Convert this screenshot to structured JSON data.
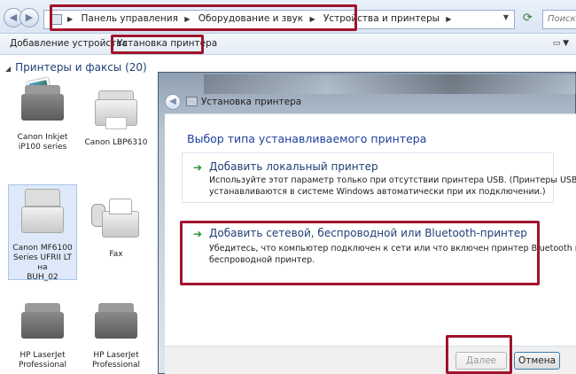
{
  "address_bar": {
    "breadcrumbs": [
      "Панель управления",
      "Оборудование и звук",
      "Устройства и принтеры"
    ],
    "search_placeholder": "Поиск: У"
  },
  "toolbar": {
    "add_device": "Добавление устройства",
    "install_printer": "Установка принтера"
  },
  "left_pane": {
    "group_header": "Принтеры и факсы (20)",
    "devices": [
      {
        "label_1": "Canon Inkjet",
        "label_2": "iP100 series",
        "label_3": "",
        "icon": "inkjet-printer-icon"
      },
      {
        "label_1": "Canon LBP6310",
        "label_2": "",
        "label_3": "",
        "icon": "laser-printer-icon"
      },
      {
        "label_1": "Canon MF6100",
        "label_2": "Series UFRII LT на",
        "label_3": "BUH_02",
        "icon": "mfp-printer-icon",
        "selected": true
      },
      {
        "label_1": "Fax",
        "label_2": "",
        "label_3": "",
        "icon": "fax-icon"
      },
      {
        "label_1": "HP LaserJet",
        "label_2": "Professional",
        "label_3": "",
        "icon": "laser-printer-icon"
      },
      {
        "label_1": "HP LaserJet",
        "label_2": "Professional",
        "label_3": "",
        "icon": "laser-printer-icon"
      }
    ]
  },
  "dialog": {
    "title": "Установка принтера",
    "heading": "Выбор типа устанавливаемого принтера",
    "option_local": {
      "title": "Добавить локальный принтер",
      "desc_1": "Используйте этот параметр только при отсутствии принтера USB. (Принтеры USB",
      "desc_2": "устанавливаются в системе Windows автоматически при их подключении.)"
    },
    "option_network": {
      "title": "Добавить сетевой, беспроводной или Bluetooth-принтер",
      "desc_1": "Убедитесь, что компьютер подключен к сети или что включен принтер Bluetooth или",
      "desc_2": "беспроводной принтер."
    },
    "next_button": "Далее",
    "cancel_button": "Отмена"
  },
  "colors": {
    "highlight": "#a0132c",
    "link_blue": "#1e3f75",
    "arrow_green": "#1f8c2d"
  }
}
